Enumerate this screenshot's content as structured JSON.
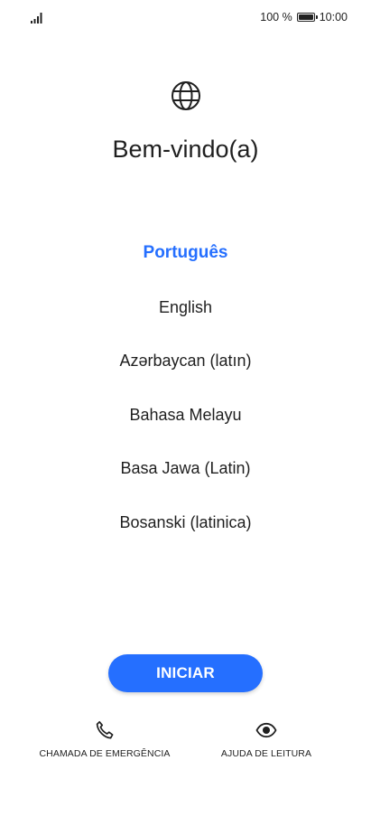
{
  "status_bar": {
    "signal_icon": "signal-icon",
    "battery_percent": "100 %",
    "battery_icon": "battery-icon",
    "time": "10:00"
  },
  "welcome": {
    "icon": "globe-icon",
    "title": "Bem-vindo(a)"
  },
  "languages": {
    "selected_index": 0,
    "items": [
      "Português",
      "English",
      "Azərbaycan (latın)",
      "Bahasa Melayu",
      "Basa Jawa (Latin)",
      "Bosanski (latinica)"
    ]
  },
  "start_button": {
    "label": "INICIAR"
  },
  "bottom_actions": {
    "emergency": {
      "icon": "phone-icon",
      "label": "CHAMADA DE EMERGÊNCIA"
    },
    "reading_aid": {
      "icon": "eye-icon",
      "label": "AJUDA DE LEITURA"
    }
  },
  "colors": {
    "accent": "#256FFF",
    "text": "#1F1F1F",
    "background": "#FFFFFF"
  }
}
